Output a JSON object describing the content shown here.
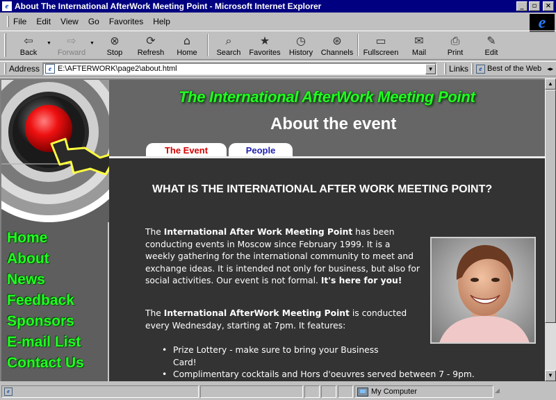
{
  "window": {
    "title": "About The International AfterWork Meeting Point - Microsoft Internet Explorer",
    "minimize": "_",
    "maximize": "▫",
    "close": "×"
  },
  "menu": {
    "items": [
      "File",
      "Edit",
      "View",
      "Go",
      "Favorites",
      "Help"
    ]
  },
  "toolbar": {
    "back": "Back",
    "forward": "Forward",
    "stop": "Stop",
    "refresh": "Refresh",
    "home": "Home",
    "search": "Search",
    "favorites": "Favorites",
    "history": "History",
    "channels": "Channels",
    "fullscreen": "Fullscreen",
    "mail": "Mail",
    "print": "Print",
    "edit": "Edit"
  },
  "address": {
    "label": "Address",
    "value": "E:\\AFTERWORK\\page2\\about.html",
    "links_label": "Links",
    "link_item": "Best of the Web"
  },
  "site": {
    "brand": "The International AfterWork Meeting Point",
    "page_title": "About the event",
    "tabs": [
      "The Event",
      "People"
    ],
    "nav": [
      "Home",
      "About",
      "News",
      "Feedback",
      "Sponsors",
      "E-mail List",
      "Contact Us"
    ],
    "heading": "WHAT IS THE INTERNATIONAL AFTER WORK MEETING POINT?",
    "p1": {
      "a": "The ",
      "b": "International After Work Meeting Point",
      "c": " has been conducting events in Moscow since February 1999. It is a weekly gathering for the international community to meet and exchange ideas. It is intended not only for business, but also for social activities. Our event is not formal. ",
      "d": "It's here for you!"
    },
    "p2": {
      "a": "The ",
      "b": "International AfterWork Meeting Point",
      "c": " is conducted every Wednesday, starting at 7pm. It features:"
    },
    "features": [
      "Prize Lottery - make sure to bring your Business Card!",
      "Complimentary cocktails and Hors d'oeuvres served between 7 - 9pm."
    ]
  },
  "status": {
    "zone": "My Computer"
  },
  "colors": {
    "titlebar": "#000080",
    "brand_green": "#22ff22",
    "page_bg": "#333333",
    "header_bg": "#666666"
  }
}
